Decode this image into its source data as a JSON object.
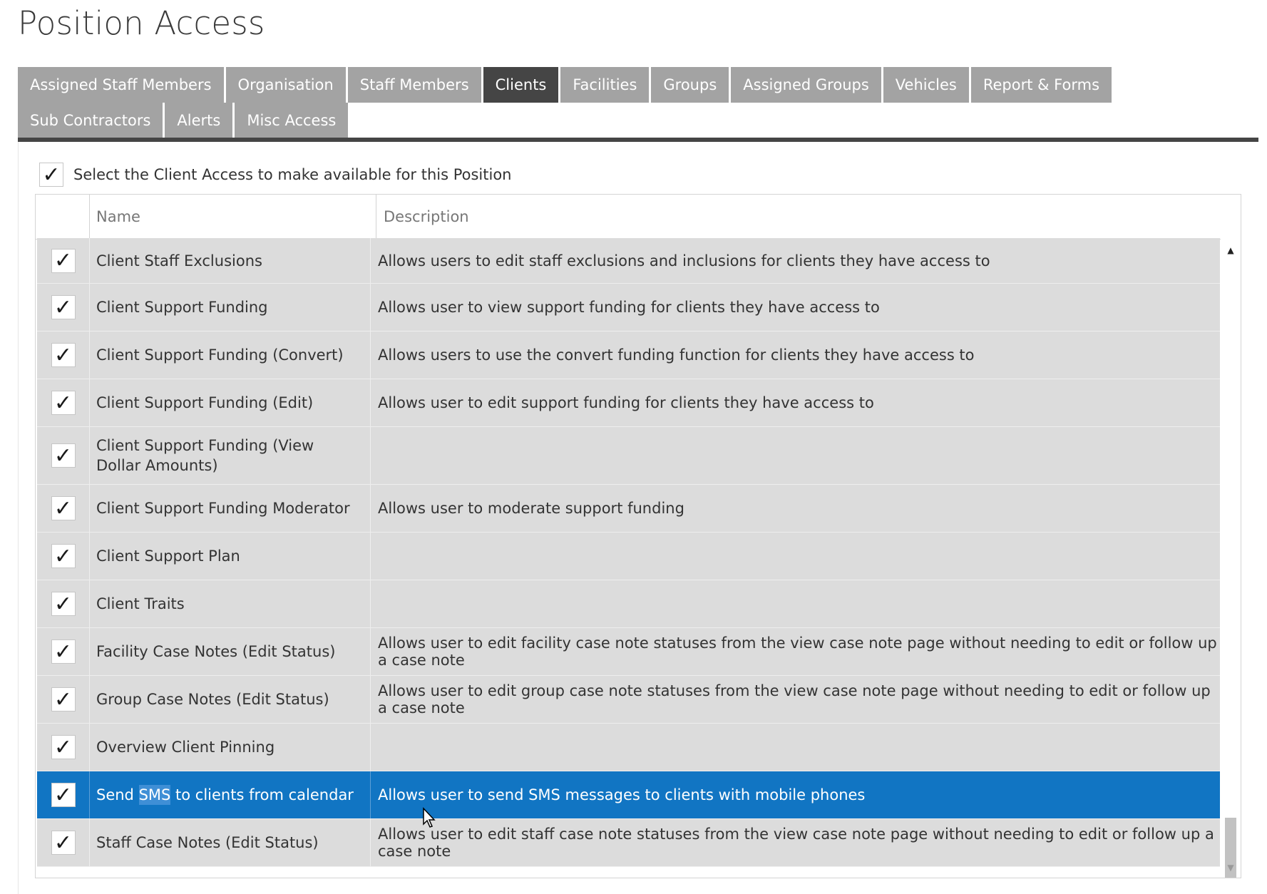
{
  "page": {
    "title": "Position Access"
  },
  "tabs": [
    {
      "label": "Assigned Staff Members",
      "active": false
    },
    {
      "label": "Organisation",
      "active": false
    },
    {
      "label": "Staff Members",
      "active": false
    },
    {
      "label": "Clients",
      "active": true
    },
    {
      "label": "Facilities",
      "active": false
    },
    {
      "label": "Groups",
      "active": false
    },
    {
      "label": "Assigned Groups",
      "active": false
    },
    {
      "label": "Vehicles",
      "active": false
    },
    {
      "label": "Report & Forms",
      "active": false
    },
    {
      "label": "Sub Contractors",
      "active": false
    },
    {
      "label": "Alerts",
      "active": false
    },
    {
      "label": "Misc Access",
      "active": false
    }
  ],
  "select_all": {
    "checked": true,
    "label": "Select the Client Access to make available for this Position"
  },
  "grid": {
    "columns": {
      "name": "Name",
      "description": "Description"
    },
    "rows": [
      {
        "checked": true,
        "name": "Client Staff Exclusions",
        "description": "Allows users to edit staff exclusions and inclusions for clients they have access to",
        "selected": false
      },
      {
        "checked": true,
        "name": "Client Support Funding",
        "description": "Allows user to view support funding for clients they have access to",
        "selected": false
      },
      {
        "checked": true,
        "name": "Client Support Funding (Convert)",
        "description": "Allows users to use the convert funding function for clients they have access to",
        "selected": false
      },
      {
        "checked": true,
        "name": "Client Support Funding (Edit)",
        "description": "Allows user to edit support funding for clients they have access to",
        "selected": false
      },
      {
        "checked": true,
        "name": "Client Support Funding (View Dollar Amounts)",
        "description": "",
        "selected": false
      },
      {
        "checked": true,
        "name": "Client Support Funding Moderator",
        "description": "Allows user to moderate support funding",
        "selected": false
      },
      {
        "checked": true,
        "name": "Client Support Plan",
        "description": "",
        "selected": false
      },
      {
        "checked": true,
        "name": "Client Traits",
        "description": "",
        "selected": false
      },
      {
        "checked": true,
        "name": "Facility Case Notes (Edit Status)",
        "description": "Allows user to edit facility case note statuses from the view case note page without needing to edit or follow up a case note",
        "selected": false
      },
      {
        "checked": true,
        "name": "Group Case Notes (Edit Status)",
        "description": "Allows user to edit group case note statuses from the view case note page without needing to edit or follow up a case note",
        "selected": false
      },
      {
        "checked": true,
        "name": "Overview Client Pinning",
        "description": "",
        "selected": false
      },
      {
        "checked": true,
        "name": "Send SMS to clients from calendar",
        "name_prefix": "Send ",
        "name_highlight": "SMS",
        "name_suffix": " to clients from calendar",
        "description": "Allows user to send SMS messages to clients with mobile phones",
        "selected": true
      },
      {
        "checked": true,
        "name": "Staff Case Notes (Edit Status)",
        "description": "Allows user to edit staff case note statuses from the view case note page without needing to edit or follow up a case note",
        "selected": false
      }
    ]
  },
  "scrollbar": {
    "position_fraction": 0.92
  },
  "colors": {
    "tab_inactive": "#a3a3a3",
    "tab_active": "#454545",
    "row_bg": "#dcdcdc",
    "row_selected": "#1175c3"
  },
  "icons": {
    "check": "check-icon",
    "scroll_up": "scroll-up-arrow-icon",
    "scroll_down": "scroll-down-arrow-icon",
    "cursor": "mouse-pointer-icon"
  }
}
